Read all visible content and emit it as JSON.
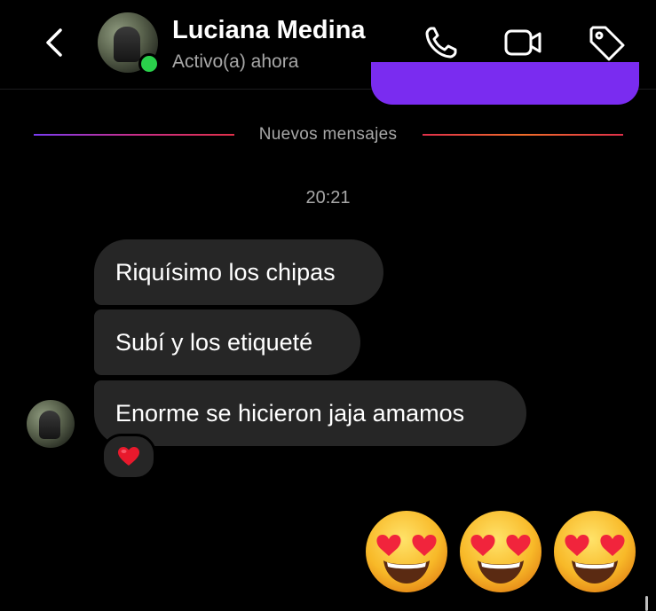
{
  "header": {
    "contact_name": "Luciana Medina",
    "status": "Activo(a) ahora",
    "icons": [
      "back-arrow-icon",
      "phone-icon",
      "video-camera-icon",
      "tag-icon"
    ]
  },
  "divider": {
    "label": "Nuevos mensajes"
  },
  "timestamp": "20:21",
  "messages": [
    {
      "text": "Riquísimo los chipas"
    },
    {
      "text": "Subí y los etiqueté"
    },
    {
      "text": "Enorme se hicieron jaja amamos"
    }
  ],
  "reaction": {
    "emoji": "red-heart-icon"
  },
  "sent_emojis": [
    "heart-eyes-emoji",
    "heart-eyes-emoji",
    "heart-eyes-emoji"
  ],
  "colors": {
    "background": "#000000",
    "bubble_received": "#262626",
    "bubble_sent": "#7a2cf0",
    "online": "#2ad14b",
    "secondary_text": "#a8a8a8"
  }
}
